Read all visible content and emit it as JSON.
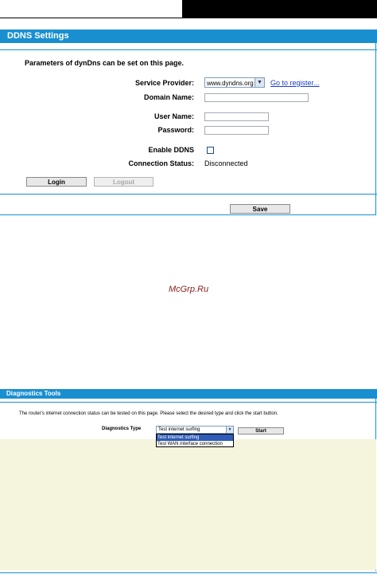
{
  "ddns": {
    "title": "DDNS Settings",
    "intro": "Parameters of dynDns can be set on this page.",
    "service_provider_label": "Service Provider:",
    "service_provider_value": "www.dyndns.org",
    "register_link": "Go to register...",
    "domain_name_label": "Domain Name:",
    "user_name_label": "User Name:",
    "password_label": "Password:",
    "enable_label": "Enable DDNS",
    "enable_checked": false,
    "status_label": "Connection Status:",
    "status_value": "Disconnected",
    "login_label": "Login",
    "logout_label": "Logout",
    "save_label": "Save"
  },
  "watermark": "McGrp.Ru",
  "diagnostics": {
    "title": "Diagnostics Tools",
    "intro": "The router's internet connection status can be tested on this page. Please select the desired type and click the start button.",
    "type_label": "Diagnostics Type",
    "selected_value": "Test internet surfing",
    "options": [
      "Test internet surfing",
      "Test WAN interface connection"
    ],
    "start_label": "Start"
  },
  "colors": {
    "accent": "#1a8fd0",
    "panel_bg": "#f5f4dc",
    "link": "#1a3fc7"
  }
}
